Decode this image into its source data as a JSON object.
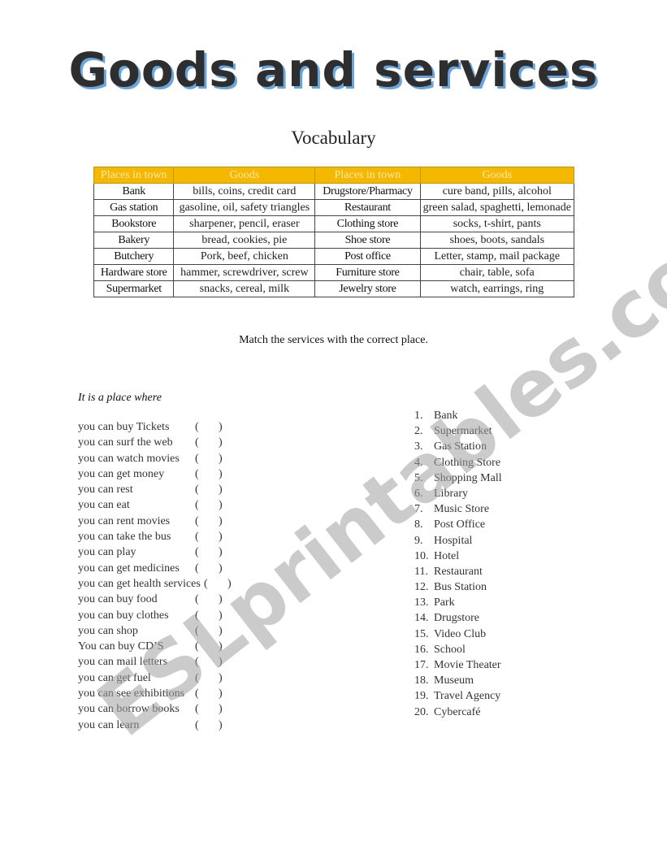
{
  "title": "Goods and services",
  "subtitle": "Vocabulary",
  "vocab_table": {
    "headers": [
      "Places in town",
      "Goods",
      "Places in town",
      "Goods"
    ],
    "rows": [
      [
        "Bank",
        "bills, coins, credit card",
        "Drugstore/Pharmacy",
        "cure band, pills, alcohol"
      ],
      [
        "Gas station",
        "gasoline, oil, safety triangles",
        "Restaurant",
        "green salad, spaghetti, lemonade"
      ],
      [
        "Bookstore",
        "sharpener, pencil, eraser",
        "Clothing store",
        "socks, t-shirt, pants"
      ],
      [
        "Bakery",
        "bread, cookies, pie",
        "Shoe store",
        "shoes, boots, sandals"
      ],
      [
        "Butchery",
        "Pork, beef, chicken",
        "Post office",
        "Letter, stamp, mail package"
      ],
      [
        "Hardware store",
        "hammer, screwdriver, screw",
        "Furniture store",
        "chair, table, sofa"
      ],
      [
        "Supermarket",
        "snacks, cereal, milk",
        "Jewelry store",
        "watch, earrings, ring"
      ]
    ]
  },
  "instruction": "Match the services with the correct place.",
  "lead": "It is a place where",
  "paren_open": "(",
  "paren_close": ")",
  "services": [
    "you can buy Tickets",
    "you can surf the web",
    "you can watch movies",
    "you can get money",
    "you can rest",
    "you can eat",
    "you can rent movies",
    "you can take the bus",
    "you can play",
    "you can get medicines",
    "you can get health services",
    "you can buy food",
    "you can buy clothes",
    "you can shop",
    "You can buy CD’S",
    "you can mail letters",
    "you can get fuel",
    "you can see exhibitions",
    "you can borrow books",
    "you can learn"
  ],
  "places": [
    {
      "num": "1.",
      "name": "Bank"
    },
    {
      "num": "2.",
      "name": "Supermarket"
    },
    {
      "num": "3.",
      "name": "Gas Station"
    },
    {
      "num": "4.",
      "name": "Clothing Store"
    },
    {
      "num": "5.",
      "name": "Shopping Mall"
    },
    {
      "num": "6.",
      "name": "Library"
    },
    {
      "num": "7.",
      "name": "Music Store"
    },
    {
      "num": "8.",
      "name": "Post Office"
    },
    {
      "num": "9.",
      "name": "Hospital"
    },
    {
      "num": "10.",
      "name": "Hotel"
    },
    {
      "num": "11.",
      "name": "Restaurant"
    },
    {
      "num": "12.",
      "name": "Bus Station"
    },
    {
      "num": "13.",
      "name": "Park"
    },
    {
      "num": "14.",
      "name": "Drugstore"
    },
    {
      "num": "15.",
      "name": "Video Club"
    },
    {
      "num": "16.",
      "name": "School"
    },
    {
      "num": "17.",
      "name": "Movie Theater"
    },
    {
      "num": "18.",
      "name": "Museum"
    },
    {
      "num": "19.",
      "name": "Travel Agency"
    },
    {
      "num": "20.",
      "name": "Cybercafé"
    }
  ],
  "watermark": "ESLprintables.com",
  "colors": {
    "header_bg": "#f5b800",
    "header_text": "#fde9a8",
    "title_shadow": "#6aa6dc"
  }
}
